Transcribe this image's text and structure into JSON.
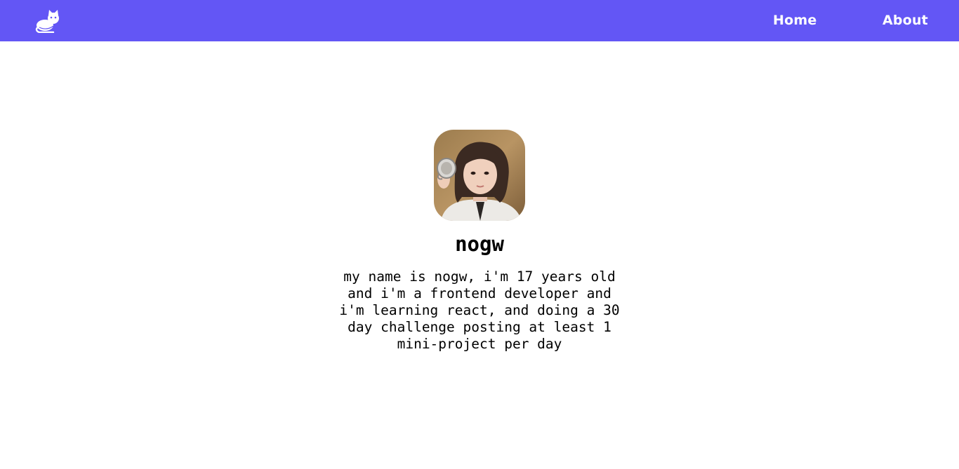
{
  "navbar": {
    "background": "#6356f5",
    "logo_icon": "cat-icon",
    "links": [
      {
        "label": "Home"
      },
      {
        "label": "About"
      }
    ]
  },
  "profile": {
    "avatar_alt": "profile photo",
    "name": "nogw",
    "bio": "my name is nogw, i'm 17 years old and i'm a frontend developer and i'm learning react, and doing a 30 day challenge posting at least 1 mini-project per day"
  }
}
